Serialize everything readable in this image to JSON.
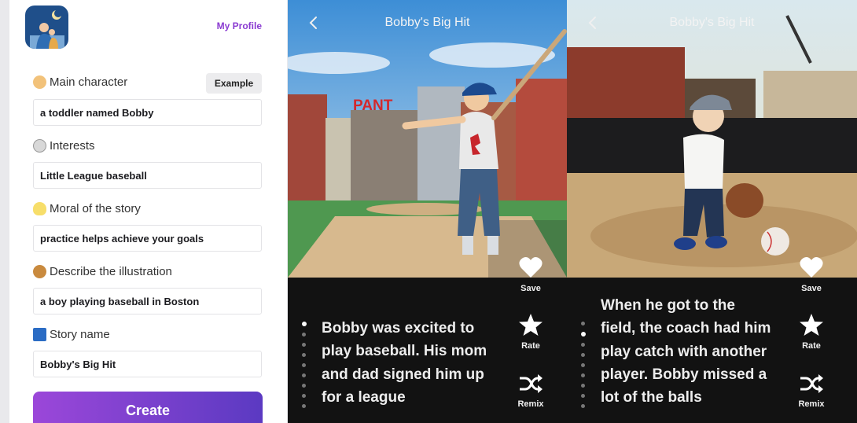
{
  "sidebar": {
    "profile_link": "My Profile",
    "example_button": "Example",
    "fields": [
      {
        "label": "Main character",
        "value": "a toddler named Bobby",
        "emoji_icon": "baby-face"
      },
      {
        "label": "Interests",
        "value": "Little League baseball",
        "emoji_icon": "baseball"
      },
      {
        "label": "Moral of the story",
        "value": "practice helps achieve your goals",
        "emoji_icon": "lightbulb"
      },
      {
        "label": "Describe the illustration",
        "value": "a boy playing baseball in Boston",
        "emoji_icon": "palette"
      },
      {
        "label": "Story name",
        "value": "Bobby's Big Hit",
        "emoji_icon": "blue-book"
      }
    ],
    "create_button": "Create"
  },
  "pages": [
    {
      "title": "Bobby's Big Hit",
      "sign_text": "PANT",
      "text_lines": [
        "Bobby was excited to",
        "play baseball. His mom",
        "and dad signed him up",
        "for a league"
      ],
      "actions": {
        "save": "Save",
        "rate": "Rate",
        "remix": "Remix"
      }
    },
    {
      "title": "Bobby's Big Hit",
      "text_lines": [
        "When he got to the",
        "field, the coach had him",
        "play catch with another",
        "player. Bobby missed a",
        "lot of the balls"
      ],
      "actions": {
        "save": "Save",
        "rate": "Rate",
        "remix": "Remix"
      }
    }
  ],
  "colors": {
    "accent": "#8a3bd1",
    "button_start": "#9b47d9",
    "button_end": "#5b3ac2",
    "page_bg": "#121212"
  }
}
